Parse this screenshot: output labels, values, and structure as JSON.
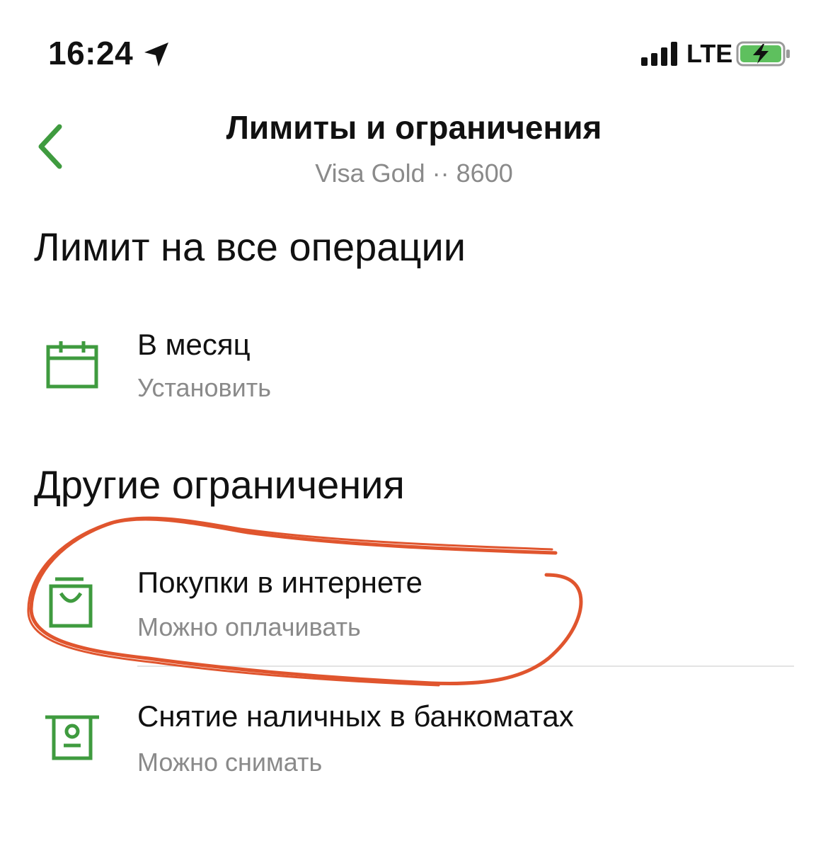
{
  "status_bar": {
    "time": "16:24",
    "network": "LTE",
    "icons": [
      "location-arrow-icon",
      "signal-bars-icon",
      "battery-charging-icon"
    ]
  },
  "header": {
    "title": "Лимиты и ограничения",
    "subtitle": "Visa Gold ·· 8600",
    "back_icon": "chevron-left-icon"
  },
  "sections": [
    {
      "title": "Лимит на все операции",
      "items": [
        {
          "title": "В месяц",
          "subtitle": "Установить",
          "icon": "calendar-icon"
        }
      ]
    },
    {
      "title": "Другие ограничения",
      "items": [
        {
          "title": "Покупки в интернете",
          "subtitle": "Можно оплачивать",
          "icon": "shopping-bag-icon"
        },
        {
          "title": "Снятие наличных в банкоматах",
          "subtitle": "Можно снимать",
          "icon": "atm-icon"
        }
      ]
    }
  ],
  "colors": {
    "accent": "#3f9b3f",
    "annotation": "#e0552e",
    "secondary_text": "#8a8a8a"
  }
}
